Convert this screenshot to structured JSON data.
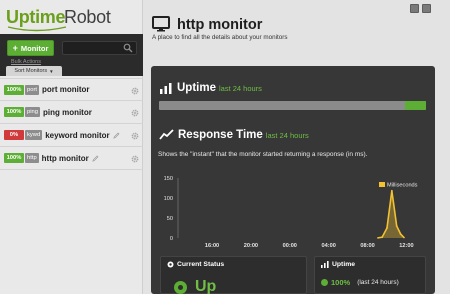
{
  "logo": {
    "part1": "Uptime",
    "part2": "Robot"
  },
  "toolbar": {
    "add_plus": "+",
    "add_label": "Monitor",
    "bulk_actions": "Bulk Actions",
    "sort_label": "Sort Monitors",
    "sort_caret": "▼"
  },
  "monitors": [
    {
      "pct": "100%",
      "type": "port",
      "name": "port monitor",
      "status": "up"
    },
    {
      "pct": "100%",
      "type": "ping",
      "name": "ping monitor",
      "status": "up"
    },
    {
      "pct": "0%",
      "type": "kywd",
      "name": "keyword monitor",
      "status": "down"
    },
    {
      "pct": "100%",
      "type": "http",
      "name": "http monitor",
      "status": "up"
    }
  ],
  "page": {
    "title": "http monitor",
    "subtitle": "A place to find all the details about your monitors"
  },
  "uptime": {
    "title": "Uptime",
    "period": "last 24 hours",
    "up_fraction": 0.08
  },
  "response": {
    "title": "Response Time",
    "period": "last 24 hours",
    "description": "Shows the \"instant\" that the monitor started returning a response (in ms)."
  },
  "chart_data": {
    "type": "area",
    "xlabel": "",
    "ylabel": "",
    "ylim": [
      0,
      150
    ],
    "yticks": [
      "150",
      "100",
      "50",
      "0"
    ],
    "xticks": [
      "16:00",
      "20:00",
      "00:00",
      "04:00",
      "08:00",
      "12:00"
    ],
    "xlim_hours": [
      12.5,
      37.5
    ],
    "series": [
      {
        "name": "Milliseconds",
        "x_hours": [
          33.0,
          33.5,
          34.0,
          34.5,
          35.0,
          35.4,
          35.8
        ],
        "values": [
          0,
          2,
          25,
          118,
          30,
          10,
          0
        ]
      }
    ],
    "legend_position": "top-right",
    "grid": false
  },
  "status_card": {
    "title": "Current Status",
    "value": "Up"
  },
  "uptime_card": {
    "title": "Uptime",
    "value": "100%",
    "period": "(last 24 hours)"
  },
  "colors": {
    "accent_green": "#5cae35",
    "down_red": "#d03a3a",
    "chart_yellow": "#f2c230",
    "panel_bg": "#373737"
  }
}
